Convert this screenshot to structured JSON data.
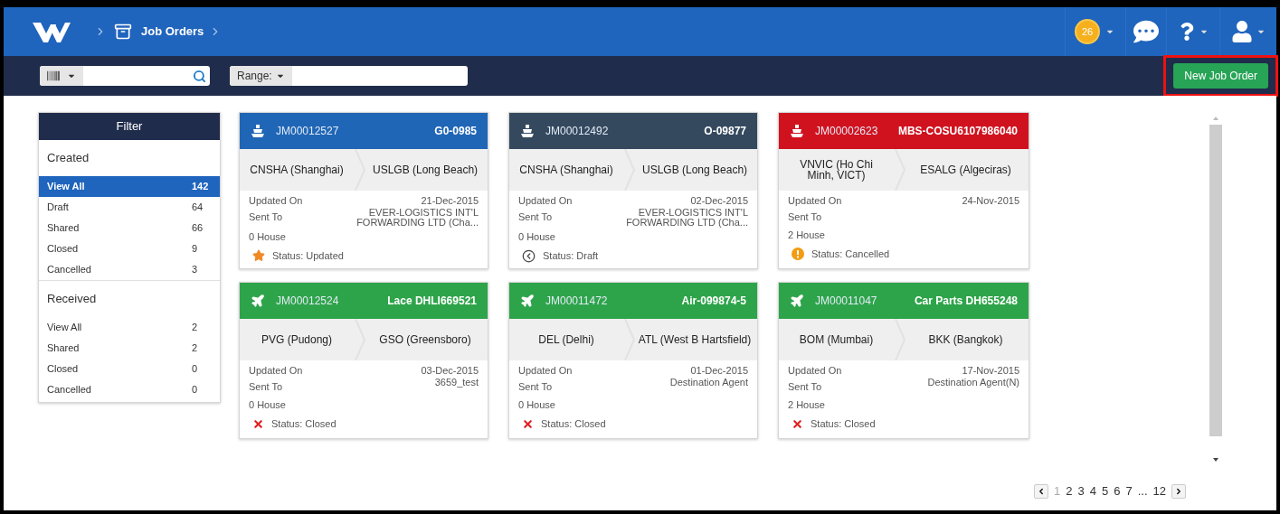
{
  "breadcrumb": {
    "title": "Job Orders"
  },
  "header": {
    "notification_count": "26"
  },
  "toolbar": {
    "range_label": "Range:",
    "new_button": {
      "label": "New Job Order",
      "highlighted": true
    }
  },
  "filter": {
    "title": "Filter",
    "sections": [
      {
        "title": "Created",
        "items": [
          {
            "label": "View All",
            "count": "142",
            "selected": true
          },
          {
            "label": "Draft",
            "count": "64",
            "selected": false
          },
          {
            "label": "Shared",
            "count": "66",
            "selected": false
          },
          {
            "label": "Closed",
            "count": "9",
            "selected": false
          },
          {
            "label": "Cancelled",
            "count": "3",
            "selected": false
          }
        ]
      },
      {
        "title": "Received",
        "items": [
          {
            "label": "View All",
            "count": "2",
            "selected": false
          },
          {
            "label": "Shared",
            "count": "2",
            "selected": false
          },
          {
            "label": "Closed",
            "count": "0",
            "selected": false
          },
          {
            "label": "Cancelled",
            "count": "0",
            "selected": false
          }
        ]
      }
    ]
  },
  "cards": [
    {
      "kind": "ship",
      "color": "#2066b6",
      "id": "JM00012527",
      "ref": "G0-0985",
      "from": "CNSHA (Shanghai)",
      "to": "USLGB (Long Beach)",
      "updated_label": "Updated On",
      "updated": "21-Dec-2015",
      "sent_label": "Sent To",
      "sent_to": "EVER-LOGISTICS INT'L FORWARDING LTD (Cha...",
      "house": "0 House",
      "status": {
        "kind": "star",
        "text": "Status: Updated"
      }
    },
    {
      "kind": "ship",
      "color": "#34495e",
      "id": "JM00012492",
      "ref": "O-09877",
      "from": "CNSHA (Shanghai)",
      "to": "USLGB (Long Beach)",
      "updated_label": "Updated On",
      "updated": "02-Dec-2015",
      "sent_label": "Sent To",
      "sent_to": "EVER-LOGISTICS INT'L FORWARDING LTD (Cha...",
      "house": "0 House",
      "status": {
        "kind": "draft",
        "text": "Status: Draft"
      }
    },
    {
      "kind": "ship",
      "color": "#d0121f",
      "id": "JM00002623",
      "ref": "MBS-COSU6107986040",
      "from": "VNVIC (Ho Chi Minh, VICT)",
      "to": "ESALG (Algeciras)",
      "updated_label": "Updated On",
      "updated": "24-Nov-2015",
      "sent_label": "Sent To",
      "house": "2 House",
      "status": {
        "kind": "warning",
        "text": "Status: Cancelled"
      }
    },
    {
      "kind": "plane",
      "color": "#2ea44a",
      "id": "JM00012524",
      "ref": "Lace DHLI669521",
      "from": "PVG (Pudong)",
      "to": "GSO (Greensboro)",
      "updated_label": "Updated On",
      "updated": "03-Dec-2015",
      "sent_label": "Sent To",
      "sent_to": "3659_test",
      "house": "0 House",
      "status": {
        "kind": "closed",
        "text": "Status: Closed"
      }
    },
    {
      "kind": "plane",
      "color": "#2ea44a",
      "id": "JM00011472",
      "ref": "Air-099874-5",
      "from": "DEL (Delhi)",
      "to": "ATL (West B Hartsfield)",
      "updated_label": "Updated On",
      "updated": "01-Dec-2015",
      "sent_label": "Sent To",
      "sent_to": "Destination Agent",
      "house": "0 House",
      "status": {
        "kind": "closed",
        "text": "Status: Closed"
      }
    },
    {
      "kind": "plane",
      "color": "#2ea44a",
      "id": "JM00011047",
      "ref": "Car Parts DH655248",
      "from": "BOM (Mumbai)",
      "to": "BKK (Bangkok)",
      "updated_label": "Updated On",
      "updated": "17-Nov-2015",
      "sent_label": "Sent To",
      "sent_to": "Destination Agent(N)",
      "house": "2 House",
      "status": {
        "kind": "closed",
        "text": "Status: Closed"
      }
    }
  ],
  "pagination": [
    {
      "label": "1",
      "selected": true
    },
    {
      "label": "2",
      "selected": false
    },
    {
      "label": "3",
      "selected": false
    },
    {
      "label": "4",
      "selected": false
    },
    {
      "label": "5",
      "selected": false
    },
    {
      "label": "6",
      "selected": false
    },
    {
      "label": "7",
      "selected": false
    },
    {
      "label": "...",
      "selected": false
    },
    {
      "label": "12",
      "selected": false
    }
  ]
}
